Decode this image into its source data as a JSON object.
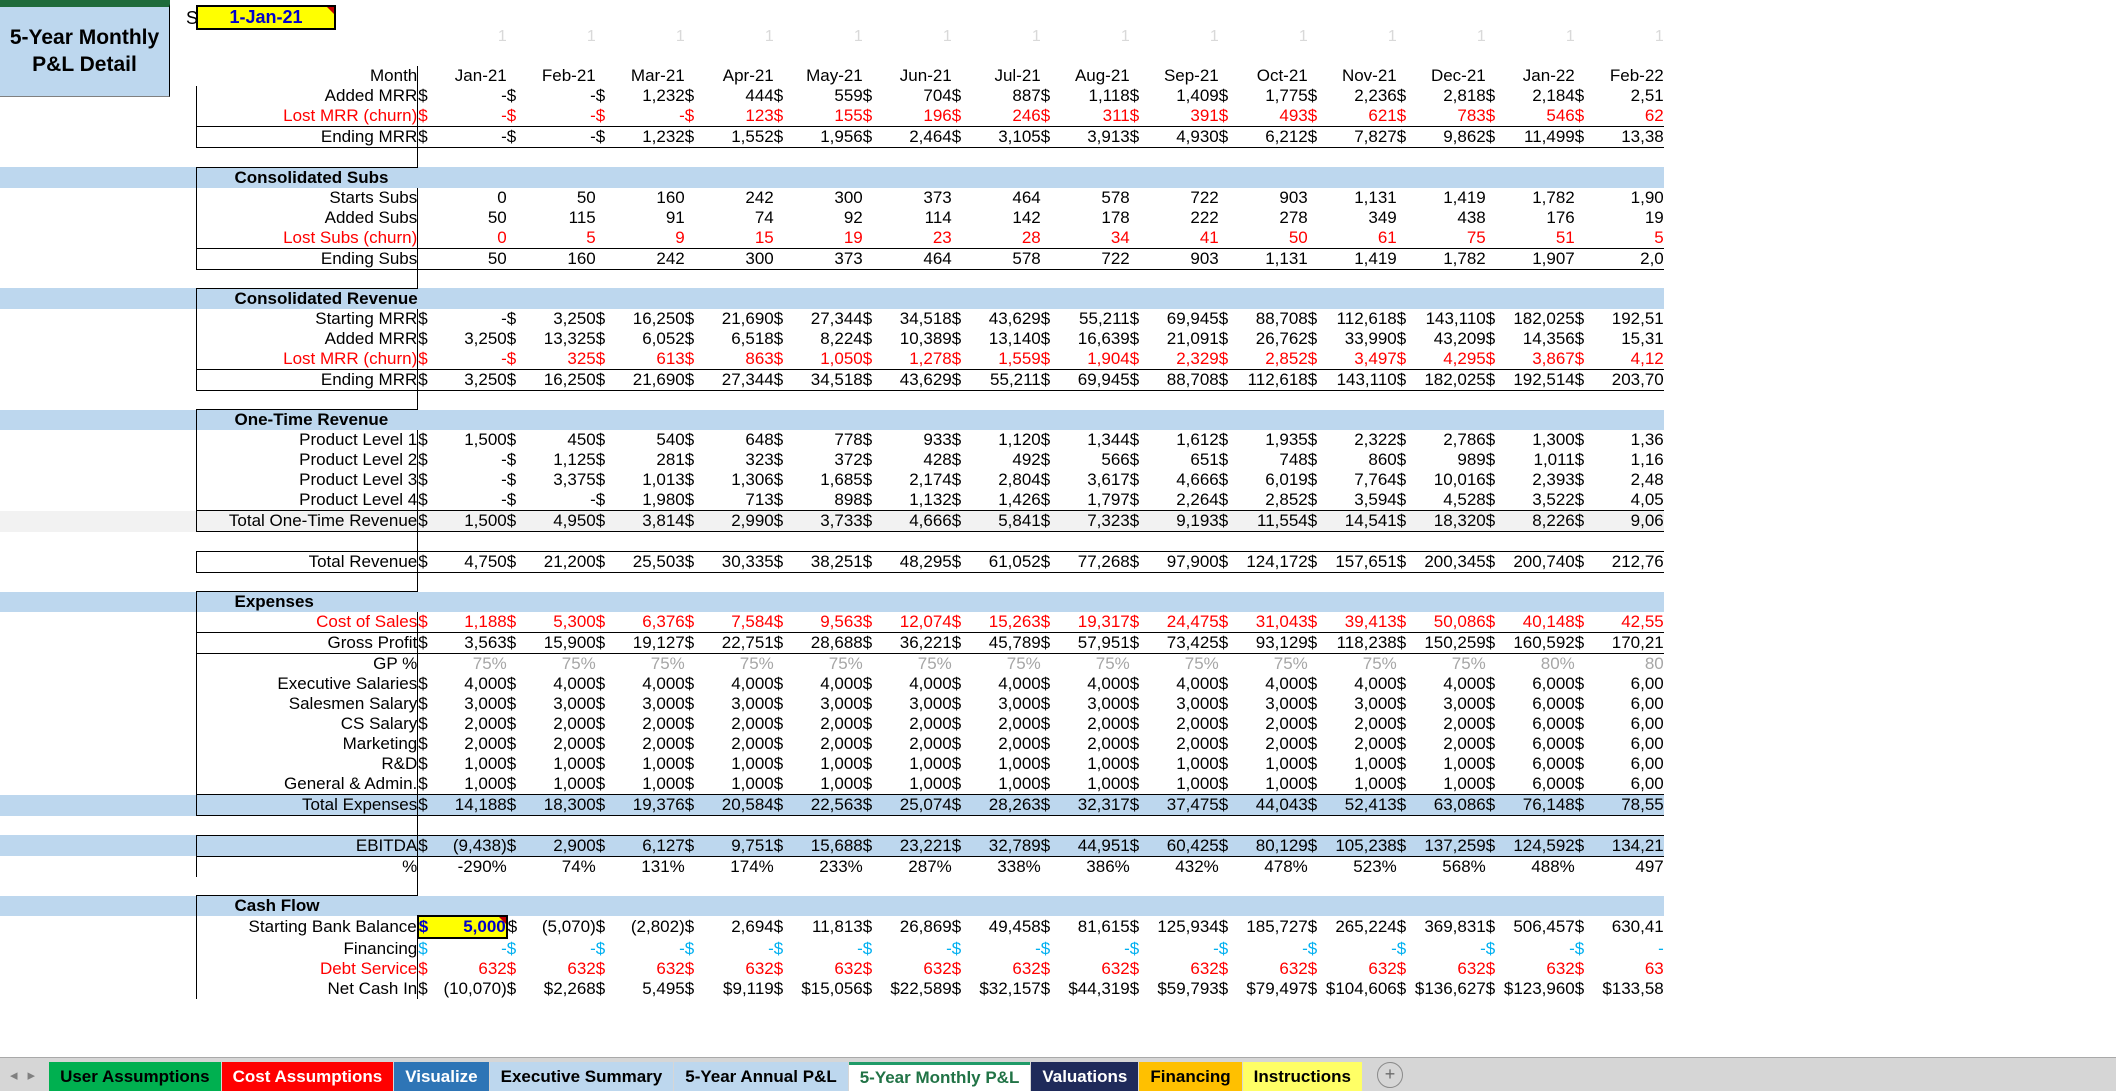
{
  "title": {
    "line1": "5-Year Monthly",
    "line2": "P&L Detail"
  },
  "start_year": {
    "label": "Start Year",
    "value": "1-Jan-21"
  },
  "ones_row": [
    "1",
    "1",
    "1",
    "1",
    "1",
    "1",
    "1",
    "1",
    "1",
    "1",
    "1",
    "1",
    "1",
    "1"
  ],
  "month_header": "Month",
  "months": [
    "Jan-21",
    "Feb-21",
    "Mar-21",
    "Apr-21",
    "May-21",
    "Jun-21",
    "Jul-21",
    "Aug-21",
    "Sep-21",
    "Oct-21",
    "Nov-21",
    "Dec-21",
    "Jan-22",
    "Feb-22"
  ],
  "colors": {
    "accent_blue": "#bdd7ee",
    "negative_red": "#ff0000",
    "grey_text": "#a6a6a6",
    "cyan_text": "#00b0f0",
    "input_yellow": "#ffff00",
    "input_text_blue": "#0000cc",
    "active_tab_green": "#1f9b68"
  },
  "sections": [
    {
      "name": "mrr-top",
      "header": null,
      "rows": [
        {
          "label": "Added MRR",
          "style": "black",
          "sym": "$",
          "values": [
            "-",
            "-",
            "1,232",
            "444",
            "559",
            "704",
            "887",
            "1,118",
            "1,409",
            "1,775",
            "2,236",
            "2,818",
            "2,184",
            "2,51"
          ]
        },
        {
          "label": "Lost MRR (churn)",
          "style": "red",
          "sym": "$",
          "values": [
            "-",
            "-",
            "-",
            "123",
            "155",
            "196",
            "246",
            "311",
            "391",
            "493",
            "621",
            "783",
            "546",
            "62"
          ]
        },
        {
          "label": "Ending MRR",
          "style": "black",
          "sym": "$",
          "values": [
            "-",
            "-",
            "1,232",
            "1,552",
            "1,956",
            "2,464",
            "3,105",
            "3,913",
            "4,930",
            "6,212",
            "7,827",
            "9,862",
            "11,499",
            "13,38"
          ]
        }
      ]
    },
    {
      "name": "consolidated-subs",
      "header": "Consolidated Subs",
      "rows": [
        {
          "label": "Starts Subs",
          "style": "black",
          "sym": "",
          "values": [
            "0",
            "50",
            "160",
            "242",
            "300",
            "373",
            "464",
            "578",
            "722",
            "903",
            "1,131",
            "1,419",
            "1,782",
            "1,90"
          ]
        },
        {
          "label": "Added Subs",
          "style": "black",
          "sym": "",
          "values": [
            "50",
            "115",
            "91",
            "74",
            "92",
            "114",
            "142",
            "178",
            "222",
            "278",
            "349",
            "438",
            "176",
            "19"
          ]
        },
        {
          "label": "Lost Subs (churn)",
          "style": "red",
          "sym": "",
          "values": [
            "0",
            "5",
            "9",
            "15",
            "19",
            "23",
            "28",
            "34",
            "41",
            "50",
            "61",
            "75",
            "51",
            "5"
          ]
        },
        {
          "label": "Ending Subs",
          "style": "black",
          "sym": "",
          "values": [
            "50",
            "160",
            "242",
            "300",
            "373",
            "464",
            "578",
            "722",
            "903",
            "1,131",
            "1,419",
            "1,782",
            "1,907",
            "2,0"
          ]
        }
      ]
    },
    {
      "name": "consolidated-revenue",
      "header": "Consolidated Revenue",
      "rows": [
        {
          "label": "Starting MRR",
          "style": "black",
          "sym": "$",
          "values": [
            "-",
            "3,250",
            "16,250",
            "21,690",
            "27,344",
            "34,518",
            "43,629",
            "55,211",
            "69,945",
            "88,708",
            "112,618",
            "143,110",
            "182,025",
            "192,51"
          ]
        },
        {
          "label": "Added MRR",
          "style": "black",
          "sym": "$",
          "values": [
            "3,250",
            "13,325",
            "6,052",
            "6,518",
            "8,224",
            "10,389",
            "13,140",
            "16,639",
            "21,091",
            "26,762",
            "33,990",
            "43,209",
            "14,356",
            "15,31"
          ]
        },
        {
          "label": "Lost MRR (churn)",
          "style": "red",
          "sym": "$",
          "values": [
            "-",
            "325",
            "613",
            "863",
            "1,050",
            "1,278",
            "1,559",
            "1,904",
            "2,329",
            "2,852",
            "3,497",
            "4,295",
            "3,867",
            "4,12"
          ]
        },
        {
          "label": "Ending MRR",
          "style": "black",
          "sym": "$",
          "values": [
            "3,250",
            "16,250",
            "21,690",
            "27,344",
            "34,518",
            "43,629",
            "55,211",
            "69,945",
            "88,708",
            "112,618",
            "143,110",
            "182,025",
            "192,514",
            "203,70"
          ]
        }
      ]
    },
    {
      "name": "one-time-revenue",
      "header": "One-Time Revenue",
      "rows": [
        {
          "label": "Product Level 1",
          "style": "black",
          "sym": "$",
          "values": [
            "1,500",
            "450",
            "540",
            "648",
            "778",
            "933",
            "1,120",
            "1,344",
            "1,612",
            "1,935",
            "2,322",
            "2,786",
            "1,300",
            "1,36"
          ]
        },
        {
          "label": "Product Level 2",
          "style": "black",
          "sym": "$",
          "values": [
            "-",
            "1,125",
            "281",
            "323",
            "372",
            "428",
            "492",
            "566",
            "651",
            "748",
            "860",
            "989",
            "1,011",
            "1,16"
          ]
        },
        {
          "label": "Product Level 3",
          "style": "black",
          "sym": "$",
          "values": [
            "-",
            "3,375",
            "1,013",
            "1,306",
            "1,685",
            "2,174",
            "2,804",
            "3,617",
            "4,666",
            "6,019",
            "7,764",
            "10,016",
            "2,393",
            "2,48"
          ]
        },
        {
          "label": "Product Level 4",
          "style": "black",
          "sym": "$",
          "values": [
            "-",
            "-",
            "1,980",
            "713",
            "898",
            "1,132",
            "1,426",
            "1,797",
            "2,264",
            "2,852",
            "3,594",
            "4,528",
            "3,522",
            "4,05"
          ]
        },
        {
          "label": "Total One-Time Revenue",
          "style": "total-shade",
          "sym": "$",
          "values": [
            "1,500",
            "4,950",
            "3,814",
            "2,990",
            "3,733",
            "4,666",
            "5,841",
            "7,323",
            "9,193",
            "11,554",
            "14,541",
            "18,320",
            "8,226",
            "9,06"
          ]
        }
      ]
    },
    {
      "name": "total-revenue",
      "header": null,
      "rows": [
        {
          "label": "Total Revenue",
          "style": "grand",
          "sym": "$",
          "values": [
            "4,750",
            "21,200",
            "25,503",
            "30,335",
            "38,251",
            "48,295",
            "61,052",
            "77,268",
            "97,900",
            "124,172",
            "157,651",
            "200,345",
            "200,740",
            "212,76"
          ]
        }
      ]
    },
    {
      "name": "expenses",
      "header": "Expenses",
      "rows": [
        {
          "label": "Cost of Sales",
          "style": "red",
          "sym": "$",
          "values": [
            "1,188",
            "5,300",
            "6,376",
            "7,584",
            "9,563",
            "12,074",
            "15,263",
            "19,317",
            "24,475",
            "31,043",
            "39,413",
            "50,086",
            "40,148",
            "42,55"
          ]
        },
        {
          "label": "Gross Profit",
          "style": "black",
          "sym": "$",
          "values": [
            "3,563",
            "15,900",
            "19,127",
            "22,751",
            "28,688",
            "36,221",
            "45,789",
            "57,951",
            "73,425",
            "93,129",
            "118,238",
            "150,259",
            "160,592",
            "170,21"
          ]
        },
        {
          "label": "GP %",
          "style": "grey",
          "sym": "",
          "values": [
            "75%",
            "75%",
            "75%",
            "75%",
            "75%",
            "75%",
            "75%",
            "75%",
            "75%",
            "75%",
            "75%",
            "75%",
            "80%",
            "80"
          ]
        },
        {
          "label": "Executive Salaries",
          "style": "black",
          "sym": "$",
          "values": [
            "4,000",
            "4,000",
            "4,000",
            "4,000",
            "4,000",
            "4,000",
            "4,000",
            "4,000",
            "4,000",
            "4,000",
            "4,000",
            "4,000",
            "6,000",
            "6,00"
          ]
        },
        {
          "label": "Salesmen Salary",
          "style": "black",
          "sym": "$",
          "values": [
            "3,000",
            "3,000",
            "3,000",
            "3,000",
            "3,000",
            "3,000",
            "3,000",
            "3,000",
            "3,000",
            "3,000",
            "3,000",
            "3,000",
            "6,000",
            "6,00"
          ]
        },
        {
          "label": "CS Salary",
          "style": "black",
          "sym": "$",
          "values": [
            "2,000",
            "2,000",
            "2,000",
            "2,000",
            "2,000",
            "2,000",
            "2,000",
            "2,000",
            "2,000",
            "2,000",
            "2,000",
            "2,000",
            "6,000",
            "6,00"
          ]
        },
        {
          "label": "Marketing",
          "style": "black",
          "sym": "$",
          "values": [
            "2,000",
            "2,000",
            "2,000",
            "2,000",
            "2,000",
            "2,000",
            "2,000",
            "2,000",
            "2,000",
            "2,000",
            "2,000",
            "2,000",
            "6,000",
            "6,00"
          ]
        },
        {
          "label": "R&D",
          "style": "black",
          "sym": "$",
          "values": [
            "1,000",
            "1,000",
            "1,000",
            "1,000",
            "1,000",
            "1,000",
            "1,000",
            "1,000",
            "1,000",
            "1,000",
            "1,000",
            "1,000",
            "6,000",
            "6,00"
          ]
        },
        {
          "label": "General & Admin.",
          "style": "black",
          "sym": "$",
          "values": [
            "1,000",
            "1,000",
            "1,000",
            "1,000",
            "1,000",
            "1,000",
            "1,000",
            "1,000",
            "1,000",
            "1,000",
            "1,000",
            "1,000",
            "6,000",
            "6,00"
          ]
        },
        {
          "label": "Total Expenses",
          "style": "total-blue",
          "sym": "$",
          "values": [
            "14,188",
            "18,300",
            "19,376",
            "20,584",
            "22,563",
            "25,074",
            "28,263",
            "32,317",
            "37,475",
            "44,043",
            "52,413",
            "63,086",
            "76,148",
            "78,55"
          ]
        }
      ]
    },
    {
      "name": "ebitda",
      "header": null,
      "rows": [
        {
          "label": "EBITDA",
          "style": "total-blue",
          "sym": "$",
          "values": [
            "(9,438)",
            "2,900",
            "6,127",
            "9,751",
            "15,688",
            "23,221",
            "32,789",
            "44,951",
            "60,425",
            "80,129",
            "105,238",
            "137,259",
            "124,592",
            "134,21"
          ]
        },
        {
          "label": "%",
          "style": "black-pct",
          "sym": "",
          "values": [
            "-290%",
            "74%",
            "131%",
            "174%",
            "233%",
            "287%",
            "338%",
            "386%",
            "432%",
            "478%",
            "523%",
            "568%",
            "488%",
            "497"
          ]
        }
      ]
    },
    {
      "name": "cash-flow",
      "header": "Cash Flow",
      "rows": [
        {
          "label": "Starting Bank Balance",
          "style": "input-yellow",
          "sym": "$",
          "values": [
            "5,000",
            "(5,070)",
            "(2,802)",
            "2,694",
            "11,813",
            "26,869",
            "49,458",
            "81,615",
            "125,934",
            "185,727",
            "265,224",
            "369,831",
            "506,457",
            "630,41"
          ]
        },
        {
          "label": "Financing",
          "style": "cyan",
          "sym": "$",
          "values": [
            "-",
            "-",
            "-",
            "-",
            "-",
            "-",
            "-",
            "-",
            "-",
            "-",
            "-",
            "-",
            "-",
            "-"
          ]
        },
        {
          "label": "Debt Service",
          "style": "red",
          "sym": "$",
          "values": [
            "632",
            "632",
            "632",
            "632",
            "632",
            "632",
            "632",
            "632",
            "632",
            "632",
            "632",
            "632",
            "632",
            "63"
          ]
        },
        {
          "label": "Net Cash In",
          "style": "black",
          "sym": "$",
          "values": [
            "(10,070)",
            "$2,268",
            "5,495",
            "$9,119",
            "$15,056",
            "$22,589",
            "$32,157",
            "$44,319",
            "$59,793",
            "$79,497",
            "$104,606",
            "$136,627",
            "$123,960",
            "$133,58"
          ]
        }
      ]
    }
  ],
  "tabs": [
    {
      "label": "User Assumptions",
      "bg": "#00b050",
      "fg": "#000000",
      "active": false
    },
    {
      "label": "Cost Assumptions",
      "bg": "#ff0000",
      "fg": "#ffffff",
      "active": false
    },
    {
      "label": "Visualize",
      "bg": "#2e75b6",
      "fg": "#ffffff",
      "active": false
    },
    {
      "label": "Executive Summary",
      "bg": "#bdd7ee",
      "fg": "#000000",
      "active": false
    },
    {
      "label": "5-Year Annual P&L",
      "bg": "#bdd7ee",
      "fg": "#000000",
      "active": false
    },
    {
      "label": "5-Year Monthly P&L",
      "bg": "#ffffff",
      "fg": "#217346",
      "active": true
    },
    {
      "label": "Valuations",
      "bg": "#1f2a5a",
      "fg": "#ffffff",
      "active": false
    },
    {
      "label": "Financing",
      "bg": "#ffc000",
      "fg": "#000000",
      "active": false
    },
    {
      "label": "Instructions",
      "bg": "#ffff66",
      "fg": "#000000",
      "active": false
    }
  ],
  "tabbar": {
    "prev": "◂",
    "next": "▸",
    "add": "+"
  }
}
